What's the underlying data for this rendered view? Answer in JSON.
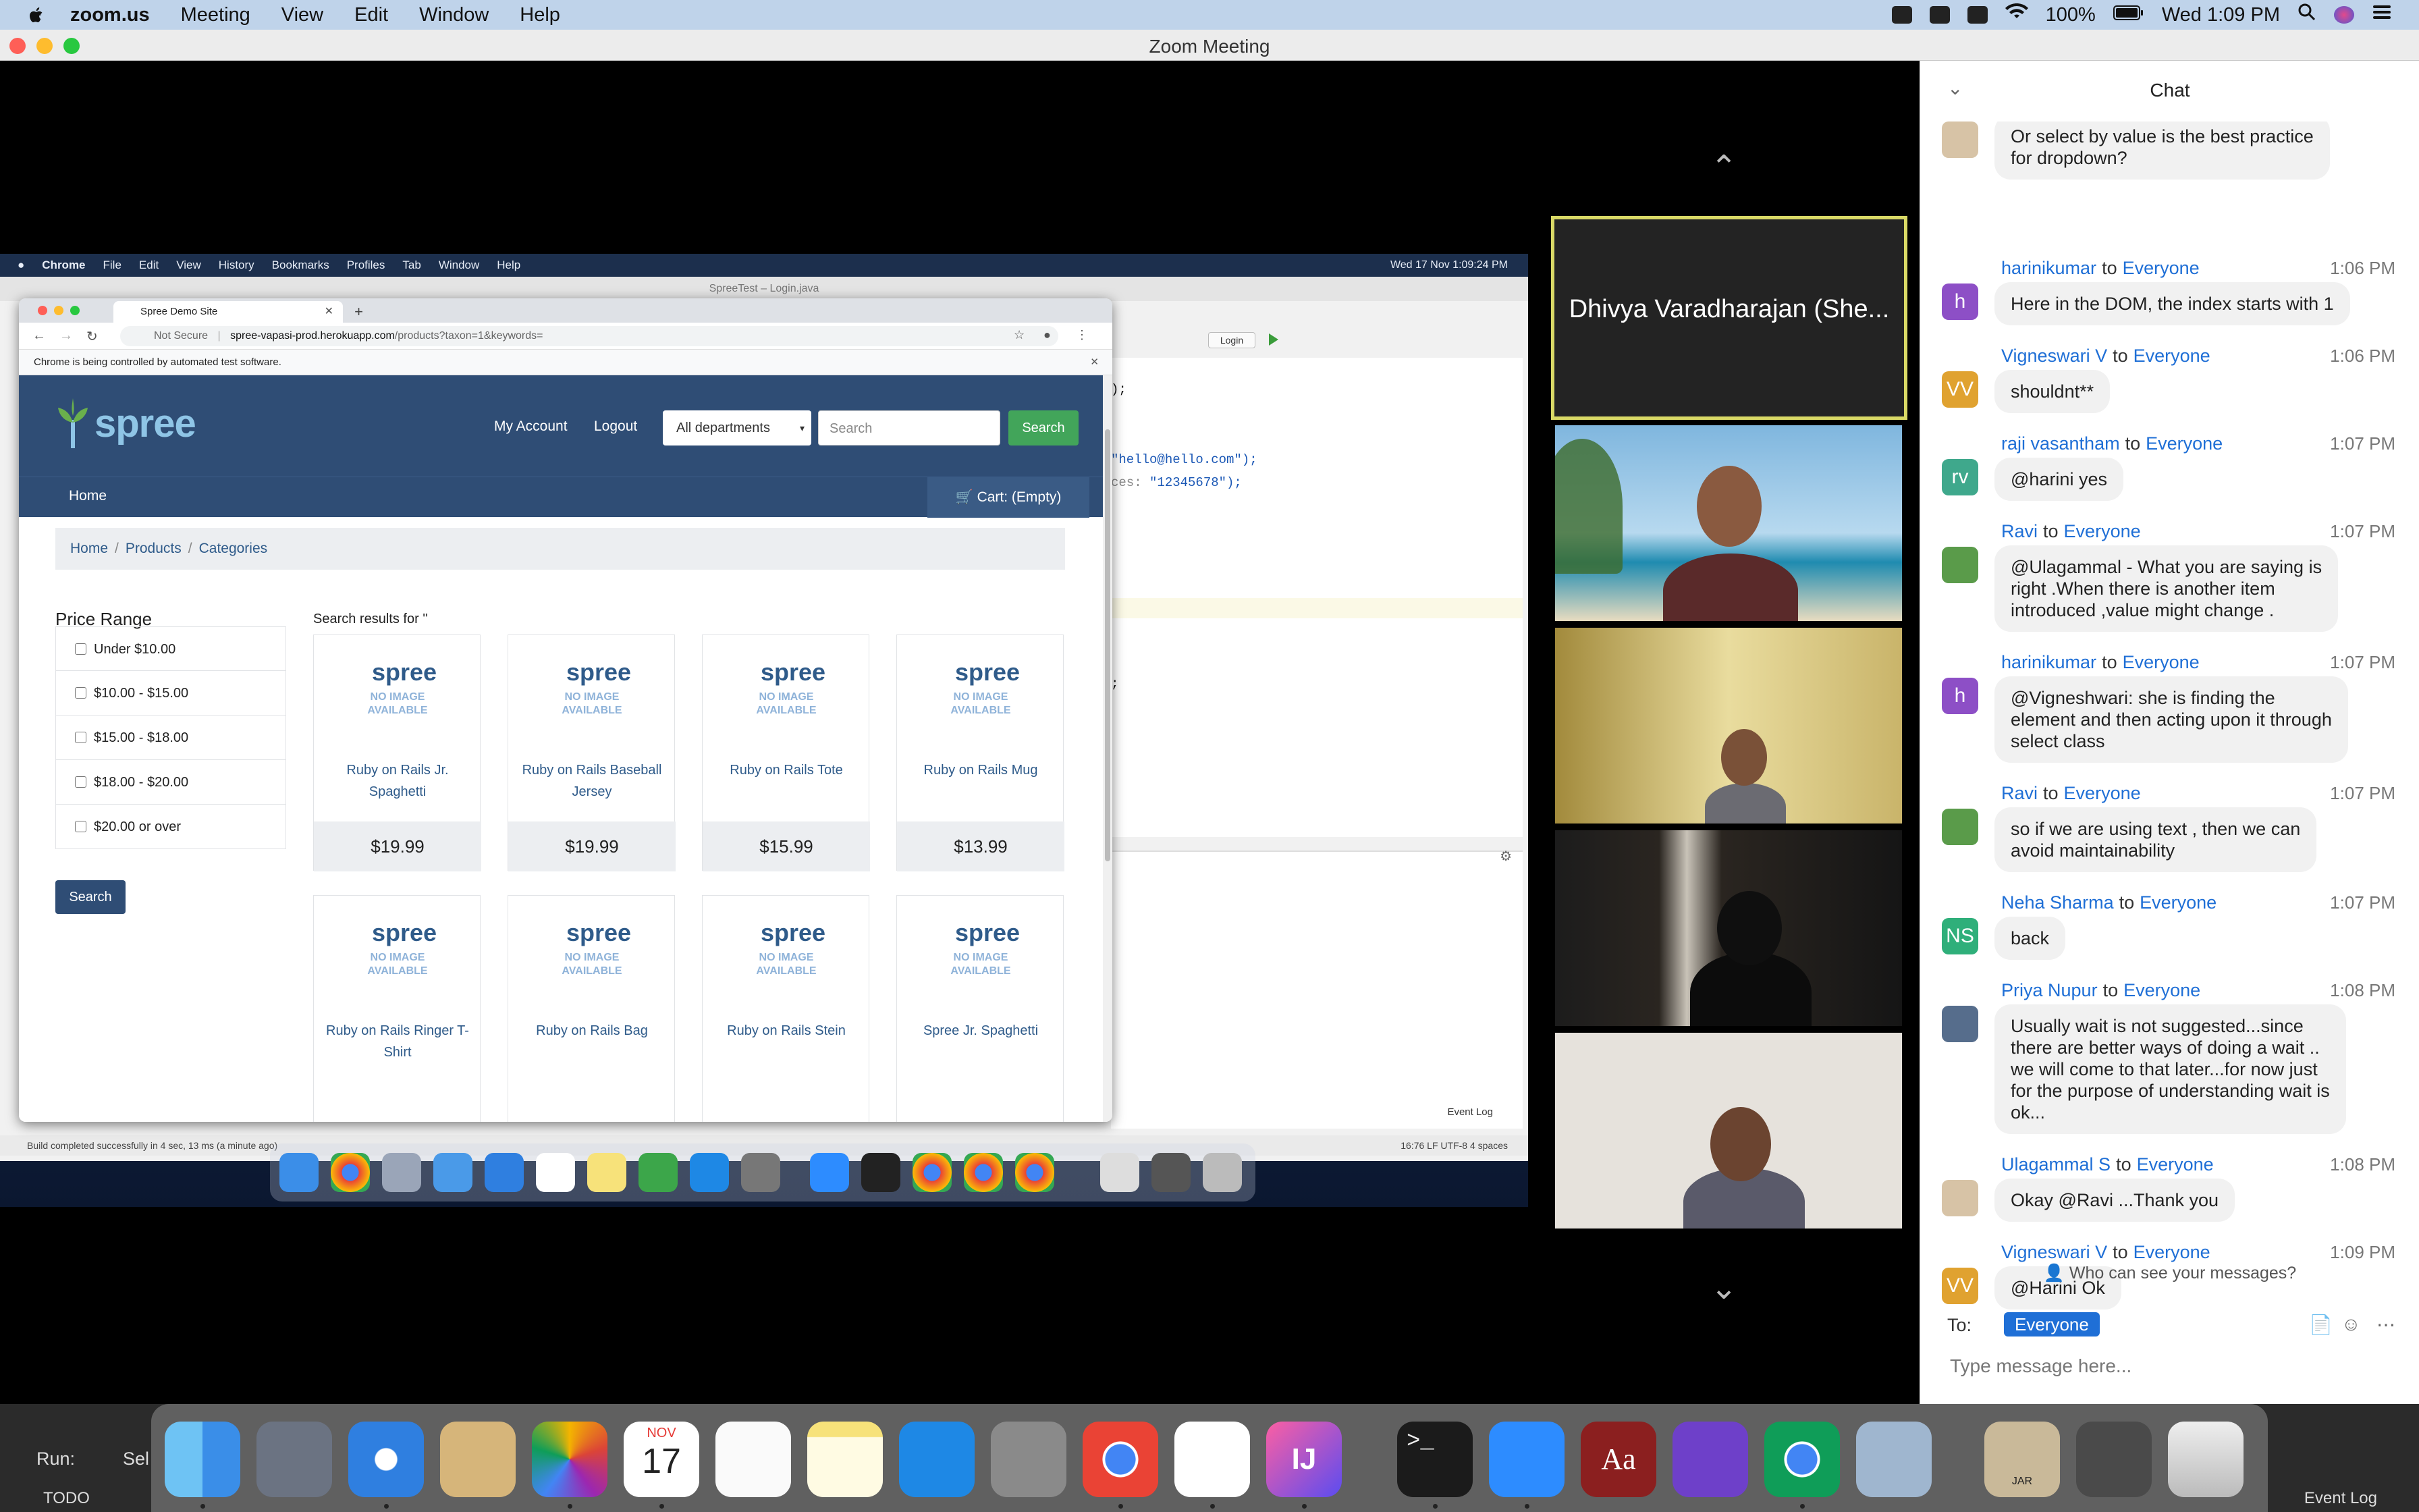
{
  "mac_menubar": {
    "app_name": "zoom.us",
    "items": [
      "Meeting",
      "View",
      "Edit",
      "Window",
      "Help"
    ],
    "battery": "100%",
    "clock": "Wed 1:09 PM"
  },
  "zoom": {
    "window_title": "Zoom Meeting"
  },
  "shared_screen": {
    "menubar": {
      "app": "Chrome",
      "items": [
        "File",
        "Edit",
        "View",
        "History",
        "Bookmarks",
        "Profiles",
        "Tab",
        "Window",
        "Help"
      ],
      "clock": "Wed 17 Nov  1:09:24 PM"
    },
    "ide": {
      "title": "SpreeTest – Login.java",
      "code_lines": [
        {
          "text": ");",
          "str": ""
        },
        {
          "text": "",
          "str": "\"hello@hello.com\");"
        },
        {
          "text": "ces: ",
          "str": "\"12345678\");"
        },
        {
          "text": ";",
          "str": ""
        }
      ],
      "run_config": "Login",
      "status_left": "Build completed successfully in 4 sec, 13 ms (a minute ago)",
      "status_right": "16:76   LF   UTF-8   4 spaces",
      "event_log": "Event Log"
    },
    "chrome": {
      "tab_title": "Spree Demo Site",
      "url_prefix": "Not Secure",
      "url_host": "spree-vapasi-prod.herokuapp.com",
      "url_path": "/products?taxon=1&keywords=",
      "infobar": "Chrome is being controlled by automated test software."
    },
    "spree": {
      "logo": "spree",
      "nav": {
        "my_account": "My Account",
        "logout": "Logout"
      },
      "department_select": "All departments",
      "search_placeholder": "Search",
      "search_button": "Search",
      "home": "Home",
      "cart": "Cart: (Empty)",
      "breadcrumb": [
        "Home",
        "Products",
        "Categories"
      ],
      "price_range_title": "Price Range",
      "price_ranges": [
        "Under $10.00",
        "$10.00 - $15.00",
        "$15.00 - $18.00",
        "$18.00 - $20.00",
        "$20.00 or over"
      ],
      "side_search_button": "Search",
      "results_title": "Search results for ''",
      "no_image_text": "NO IMAGE\nAVAILABLE",
      "products": [
        {
          "name": "Ruby on Rails Jr. Spaghetti",
          "price": "$19.99"
        },
        {
          "name": "Ruby on Rails Baseball Jersey",
          "price": "$19.99"
        },
        {
          "name": "Ruby on Rails Tote",
          "price": "$15.99"
        },
        {
          "name": "Ruby on Rails Mug",
          "price": "$13.99"
        },
        {
          "name": "Ruby on Rails Ringer T-Shirt",
          "price": ""
        },
        {
          "name": "Ruby on Rails Bag",
          "price": ""
        },
        {
          "name": "Ruby on Rails Stein",
          "price": ""
        },
        {
          "name": "Spree Jr. Spaghetti",
          "price": ""
        }
      ]
    }
  },
  "participants": {
    "active_speaker": "Dhivya Varadharajan (She..."
  },
  "chat": {
    "title": "Chat",
    "to_word": "to",
    "messages": [
      {
        "from": "",
        "to": "",
        "time": "",
        "avatar": "",
        "avatar_color": "#d7c3a6",
        "text": "Or select by value is the best practice\nfor dropdown?"
      },
      {
        "from": "harinikumar",
        "to": "Everyone",
        "time": "1:06 PM",
        "avatar": "h",
        "avatar_color": "#8d4fc6",
        "text": "Here in the DOM, the index starts with 1"
      },
      {
        "from": "Vigneswari V",
        "to": "Everyone",
        "time": "1:06 PM",
        "avatar": "VV",
        "avatar_color": "#e0a230",
        "text": "shouldnt**"
      },
      {
        "from": "raji vasantham",
        "to": "Everyone",
        "time": "1:07 PM",
        "avatar": "rv",
        "avatar_color": "#3fa88c",
        "text": "@harini yes"
      },
      {
        "from": "Ravi",
        "to": "Everyone",
        "time": "1:07 PM",
        "avatar": "",
        "avatar_color": "#5a9b4a",
        "text": "@Ulagammal - What you are saying is\nright .When there is another item\nintroduced ,value might change ."
      },
      {
        "from": "harinikumar",
        "to": "Everyone",
        "time": "1:07 PM",
        "avatar": "h",
        "avatar_color": "#8d4fc6",
        "text": "@Vigneshwari: she is finding the\nelement and then acting upon it through\nselect class"
      },
      {
        "from": "Ravi",
        "to": "Everyone",
        "time": "1:07 PM",
        "avatar": "",
        "avatar_color": "#5a9b4a",
        "text": "so if we are using text , then we can\navoid maintainability"
      },
      {
        "from": "Neha Sharma",
        "to": "Everyone",
        "time": "1:07 PM",
        "avatar": "NS",
        "avatar_color": "#2faf7a",
        "text": "back"
      },
      {
        "from": "Priya Nupur",
        "to": "Everyone",
        "time": "1:08 PM",
        "avatar": "",
        "avatar_color": "#566d8c",
        "text": "Usually wait is not suggested...since\nthere are better ways of doing a wait ..\nwe will come to that later...for now just\nfor the purpose of understanding wait is\nok..."
      },
      {
        "from": "Ulagammal  S",
        "to": "Everyone",
        "time": "1:08 PM",
        "avatar": "",
        "avatar_color": "#d7c3a6",
        "text": "Okay @Ravi ...Thank you"
      },
      {
        "from": "Vigneswari V",
        "to": "Everyone",
        "time": "1:09 PM",
        "avatar": "VV",
        "avatar_color": "#e0a230",
        "text": "@Harini Ok"
      }
    ],
    "visibility_note": "Who can see your messages?",
    "to_label": "To:",
    "to_value": "Everyone",
    "input_placeholder": "Type message here..."
  },
  "host_bottom": {
    "run_label": "Run:",
    "run_tab": "Sel",
    "todo": "TODO",
    "event_log": "Event Log",
    "calendar_month": "NOV",
    "calendar_day": "17",
    "jar_label": "JAR"
  }
}
